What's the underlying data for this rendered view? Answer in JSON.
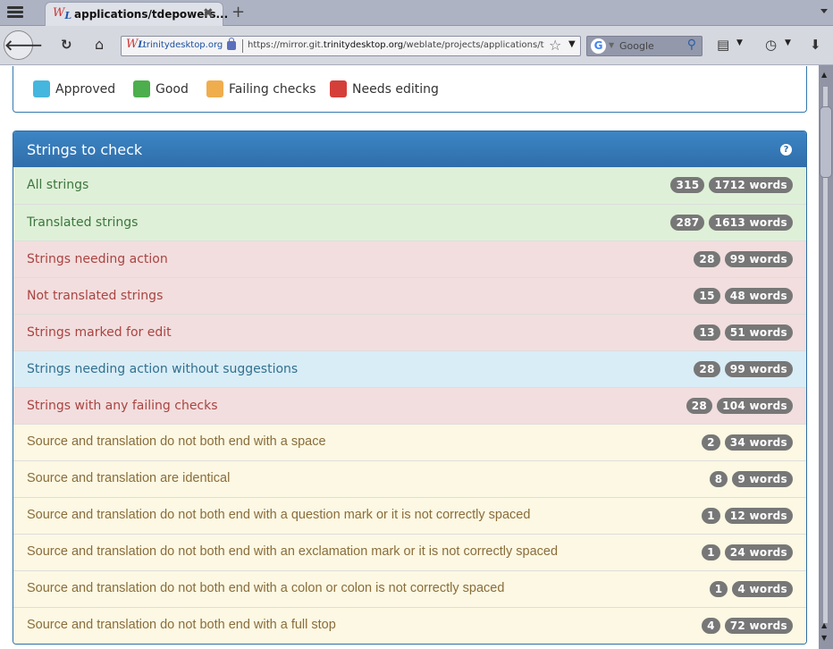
{
  "browser": {
    "tab_title": "applications/tdepowers...",
    "url_site": "trinitydesktop.org",
    "url_prefix": "https://mirror.git.",
    "url_host": "trinitydesktop.org",
    "url_path": "/weblate/projects/applications/tdep",
    "search_placeholder": "Google",
    "favicon_text": "W",
    "favicon_sub": "L"
  },
  "legend": [
    {
      "label": "Approved",
      "color": "#45b6dd"
    },
    {
      "label": "Good",
      "color": "#4cae4c"
    },
    {
      "label": "Failing checks",
      "color": "#f0ad4e"
    },
    {
      "label": "Needs editing",
      "color": "#d43f3a"
    }
  ],
  "panel": {
    "title": "Strings to check",
    "help_icon": "?"
  },
  "rows": [
    {
      "label": "All strings",
      "count": "315",
      "words": "1712 words",
      "style": "success"
    },
    {
      "label": "Translated strings",
      "count": "287",
      "words": "1613 words",
      "style": "success"
    },
    {
      "label": "Strings needing action",
      "count": "28",
      "words": "99 words",
      "style": "danger"
    },
    {
      "label": "Not translated strings",
      "count": "15",
      "words": "48 words",
      "style": "danger"
    },
    {
      "label": "Strings marked for edit",
      "count": "13",
      "words": "51 words",
      "style": "danger"
    },
    {
      "label": "Strings needing action without suggestions",
      "count": "28",
      "words": "99 words",
      "style": "info"
    },
    {
      "label": "Strings with any failing checks",
      "count": "28",
      "words": "104 words",
      "style": "danger"
    },
    {
      "label": "Source and translation do not both end with a space",
      "count": "2",
      "words": "34 words",
      "style": "warning"
    },
    {
      "label": "Source and translation are identical",
      "count": "8",
      "words": "9 words",
      "style": "warning"
    },
    {
      "label": "Source and translation do not both end with a question mark or it is not correctly spaced",
      "count": "1",
      "words": "12 words",
      "style": "warning"
    },
    {
      "label": "Source and translation do not both end with an exclamation mark or it is not correctly spaced",
      "count": "1",
      "words": "24 words",
      "style": "warning"
    },
    {
      "label": "Source and translation do not both end with a colon or colon is not correctly spaced",
      "count": "1",
      "words": "4 words",
      "style": "warning"
    },
    {
      "label": "Source and translation do not both end with a full stop",
      "count": "4",
      "words": "72 words",
      "style": "warning"
    }
  ]
}
